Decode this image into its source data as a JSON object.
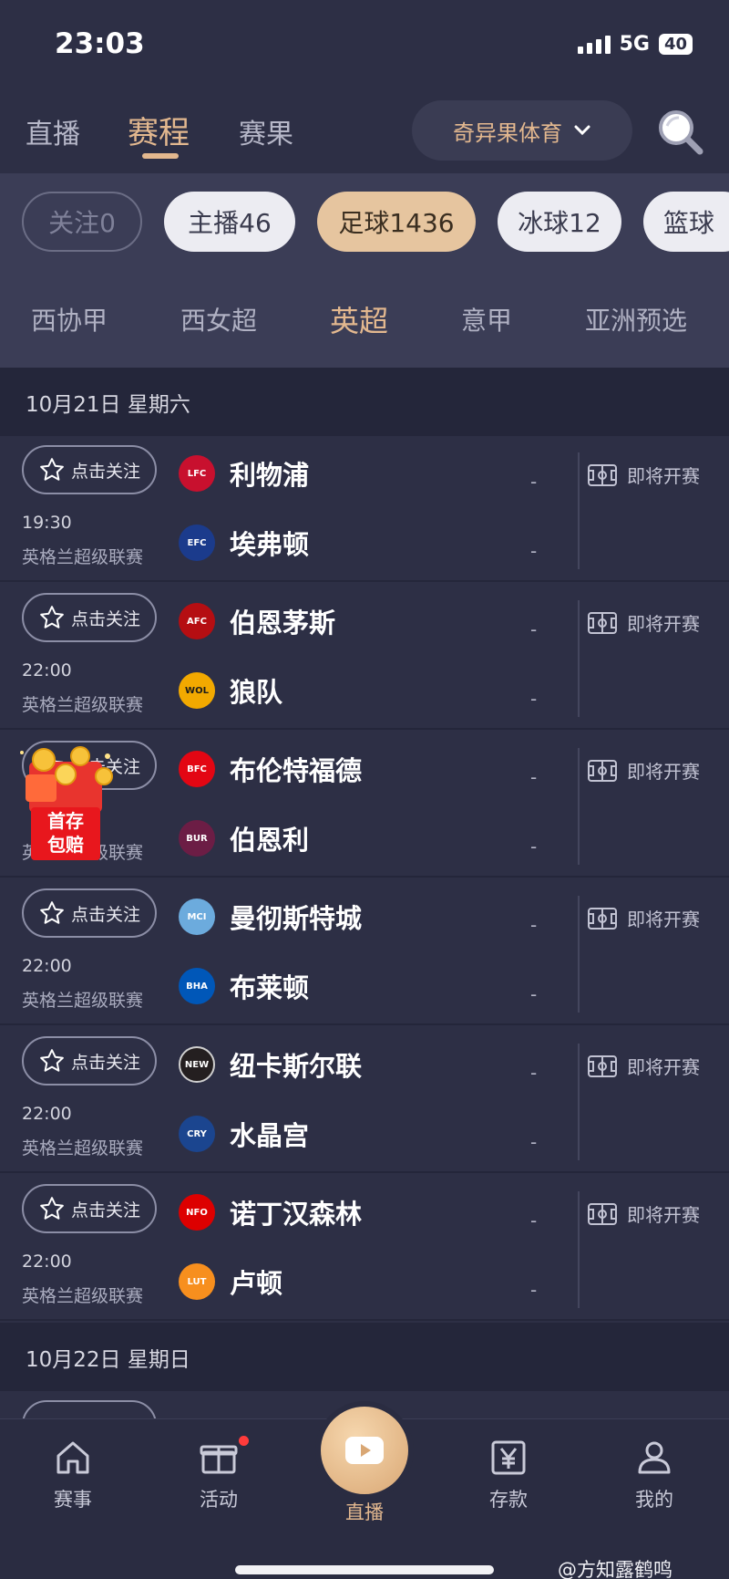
{
  "status_bar": {
    "time": "23:03",
    "network": "5G",
    "battery": "40"
  },
  "top_nav": {
    "tabs": [
      {
        "label": "直播"
      },
      {
        "label": "赛程"
      },
      {
        "label": "赛果"
      }
    ],
    "active_tab": "赛程",
    "brand": "奇异果体育"
  },
  "chips": [
    "关注0",
    "主播46",
    "足球1436",
    "冰球12",
    "篮球"
  ],
  "leagues": [
    "西协甲",
    "西女超",
    "英超",
    "意甲",
    "亚洲预选"
  ],
  "dates": [
    "10月21日  星期六",
    "10月22日  星期日"
  ],
  "follow_label": "点击关注",
  "status_label": "即将开赛",
  "score_placeholder": "-",
  "matches": [
    {
      "time": "19:30",
      "league": "英格兰超级联赛",
      "home": "利物浦",
      "away": "埃弗顿"
    },
    {
      "time": "22:00",
      "league": "英格兰超级联赛",
      "home": "伯恩茅斯",
      "away": "狼队"
    },
    {
      "time": "",
      "league": "英格兰超级联赛",
      "home": "布伦特福德",
      "away": "伯恩利"
    },
    {
      "time": "22:00",
      "league": "英格兰超级联赛",
      "home": "曼彻斯特城",
      "away": "布莱顿"
    },
    {
      "time": "22:00",
      "league": "英格兰超级联赛",
      "home": "纽卡斯尔联",
      "away": "水晶宫"
    },
    {
      "time": "22:00",
      "league": "英格兰超级联赛",
      "home": "诺丁汉森林",
      "away": "卢顿"
    }
  ],
  "promo": {
    "line1": "首存",
    "line2": "包赔"
  },
  "tab_bar": [
    "赛事",
    "活动",
    "直播",
    "存款",
    "我的"
  ],
  "watermark": "@方知露鹤鸣",
  "colors": {
    "background": "#2d2f45",
    "accent": "#e3b88f",
    "chip_active": "#e6c59f"
  }
}
